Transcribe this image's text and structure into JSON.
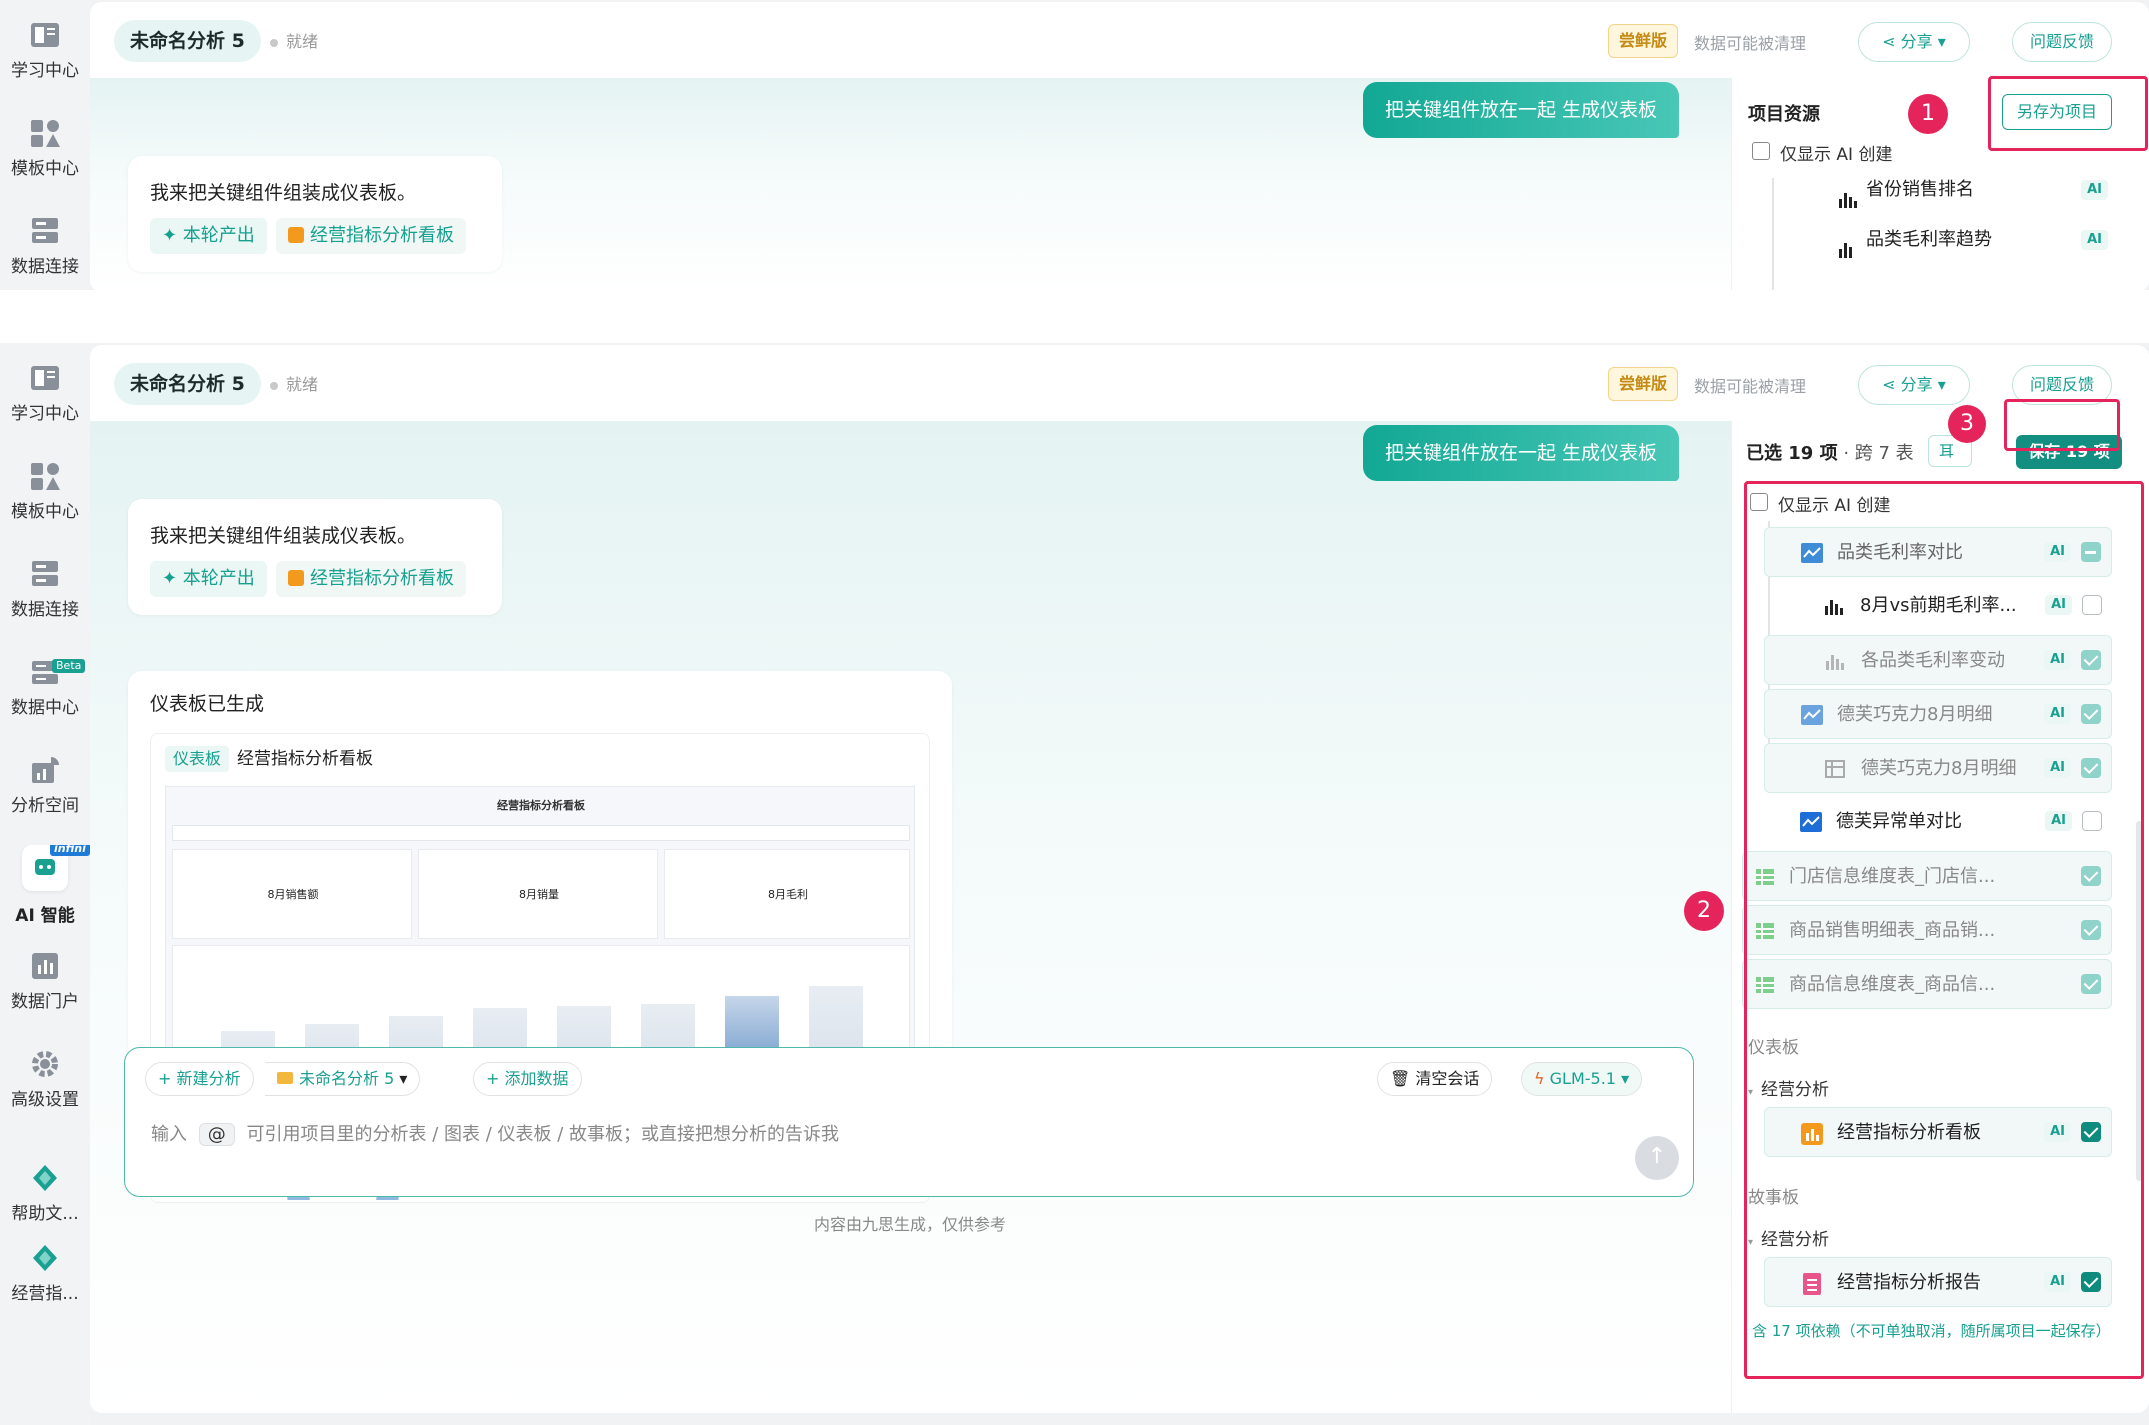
{
  "nav": {
    "learn": "学习中心",
    "template": "模板中心",
    "dataconn": "数据连接",
    "datacenter": "数据中心",
    "beta": "Beta",
    "analysis": "分析空间",
    "ai": "AI 智能",
    "infini": "infini",
    "portal": "数据门户",
    "advanced": "高级设置",
    "help": "帮助文...",
    "report": "经营指..."
  },
  "header": {
    "title": "未命名分析 5",
    "status": "就绪",
    "trial_badge": "尝鲜版",
    "trial_note": "数据可能被清理",
    "share": "分享",
    "feedback": "问题反馈"
  },
  "chat": {
    "user_msg": "把关键组件放在一起 生成仪表板",
    "ai_msg": "我来把关键组件组装成仪表板。",
    "chip_round": "✦ 本轮产出",
    "chip_board": "经营指标分析看板",
    "done_msg": "仪表板已生成",
    "card_tag": "仪表板",
    "card_title": "经营指标分析看板",
    "preview_title": "经营指标分析看板",
    "kpi1": "8月销售额",
    "kpi2": "8月销量",
    "kpi3": "8月毛利",
    "scroll_down": "↓"
  },
  "composer": {
    "new_analysis": "+ 新建分析",
    "project": "未命名分析 5",
    "add_data": "+ 添加数据",
    "clear": "清空会话",
    "model": "GLM-5.1",
    "placeholder_prefix": "输入",
    "at": "@",
    "placeholder": "可引用项目里的分析表 / 图表 / 仪表板 / 故事板；或直接把想分析的告诉我",
    "footer": "内容由九思生成，仅供参考"
  },
  "top_panel": {
    "title": "项目资源",
    "save_as": "另存为项目",
    "only_ai": "仅显示 AI 创建",
    "items": [
      {
        "label": "省份销售排名",
        "ai": "AI"
      },
      {
        "label": "品类毛利率趋势",
        "ai": "AI"
      }
    ]
  },
  "bottom_panel": {
    "selected": "已选 19 项",
    "across": "· 跨 7 表",
    "cancel_short": "耳",
    "save": "保存 19 项",
    "only_ai": "仅显示 AI 创建",
    "items": [
      {
        "label": "品类毛利率对比",
        "ai": "AI",
        "state": "indeterminate"
      },
      {
        "label": "8月vs前期毛利率...",
        "ai": "AI",
        "state": "unchecked"
      },
      {
        "label": "各品类毛利率变动",
        "ai": "AI",
        "state": "checked-soft"
      },
      {
        "label": "德芙巧克力8月明细",
        "ai": "AI",
        "state": "checked-soft"
      },
      {
        "label": "德芙巧克力8月明细",
        "ai": "AI",
        "state": "checked-soft"
      },
      {
        "label": "德芙异常单对比",
        "ai": "AI",
        "state": "unchecked"
      },
      {
        "label": "门店信息维度表_门店信...",
        "state": "checked-soft"
      },
      {
        "label": "商品销售明细表_商品销...",
        "state": "checked-soft"
      },
      {
        "label": "商品信息维度表_商品信...",
        "state": "checked-soft"
      }
    ],
    "section_dashboard": "仪表板",
    "group_dashboard": "经营分析",
    "dashboard_item": "经营指标分析看板",
    "section_story": "故事板",
    "group_story": "经营分析",
    "story_item": "经营指标分析报告",
    "ai": "AI",
    "footer_note": "含 17 项依赖（不可单独取消，随所属项目一起保存）"
  },
  "annotations": {
    "one": "1",
    "two": "2",
    "three": "3"
  },
  "colors": {
    "accent": "#19a091",
    "highlight": "#e4245a",
    "trial": "#c58a12"
  }
}
